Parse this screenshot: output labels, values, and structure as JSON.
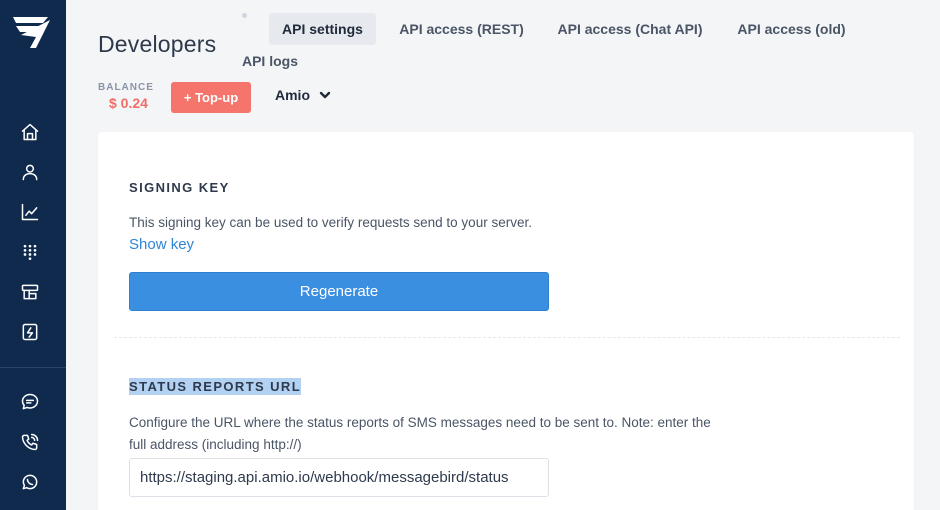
{
  "header": {
    "title": "Developers",
    "tabs": [
      {
        "label": "API settings",
        "active": true
      },
      {
        "label": "API access (REST)",
        "active": false
      },
      {
        "label": "API access (Chat API)",
        "active": false
      },
      {
        "label": "API access (old)",
        "active": false
      },
      {
        "label": "API logs",
        "active": false
      }
    ],
    "balance_label": "BALANCE",
    "balance_value": "$ 0.24",
    "topup_label": "+ Top-up",
    "account_name": "Amio"
  },
  "sidebar": {
    "icons": [
      "logo-icon",
      "home-icon",
      "user-icon",
      "chart-icon",
      "grid-dots-icon",
      "templates-icon",
      "number-icon",
      "chat-icon",
      "call-icon",
      "whatsapp-icon"
    ]
  },
  "signing_key": {
    "title": "SIGNING KEY",
    "description": "This signing key can be used to verify requests send to your server.",
    "show_key_label": "Show key",
    "regenerate_label": "Regenerate"
  },
  "status_reports": {
    "title": "STATUS REPORTS URL",
    "description_line1": "Configure the URL where the status reports of SMS messages need to be sent to. Note: enter the",
    "description_line2": "full address (including http://)",
    "url_value": "https://staging.api.amio.io/webhook/messagebird/status"
  },
  "colors": {
    "sidebar_bg": "#0f2a4c",
    "accent_blue": "#3b8fe0",
    "topup_red": "#f5746b",
    "balance_red": "#f06e65",
    "link_blue": "#2f86d8"
  }
}
